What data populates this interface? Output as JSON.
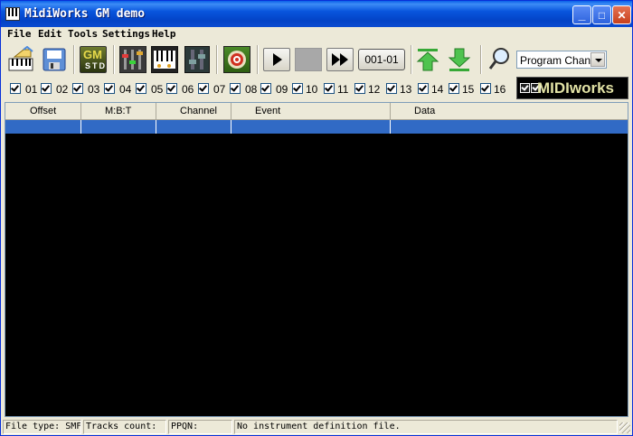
{
  "window": {
    "title": "MidiWorks GM demo"
  },
  "titlebar_buttons": {
    "minimize": "_",
    "maximize": "□",
    "close": "✕"
  },
  "menu": [
    "File",
    "Edit",
    "Tools",
    "Settings",
    "Help"
  ],
  "toolbar": {
    "gm_label": "GM",
    "std_label": "STD",
    "position": "001-01",
    "event_filter": "Program Change",
    "icons": [
      "open-icon",
      "save-icon",
      "gm-standard-icon",
      "mixer-icon",
      "piano-icon",
      "faders-icon",
      "target-icon",
      "play-icon",
      "stop-icon",
      "fast-forward-icon",
      "move-up-icon",
      "move-down-icon",
      "search-icon"
    ]
  },
  "channels": [
    "01",
    "02",
    "03",
    "04",
    "05",
    "06",
    "07",
    "08",
    "09",
    "10",
    "11",
    "12",
    "13",
    "14",
    "15",
    "16"
  ],
  "logo": "MIDIworks",
  "columns": [
    "Offset",
    "M:B:T",
    "Channel",
    "Event",
    "Data"
  ],
  "status": {
    "file_type": "File type: SMF",
    "tracks": "Tracks count:",
    "ppqn": "PPQN:",
    "instrument": "No instrument definition file."
  },
  "colors": {
    "title": "#0A4BD0",
    "selection": "#316AC5",
    "list_bg": "#000000"
  }
}
